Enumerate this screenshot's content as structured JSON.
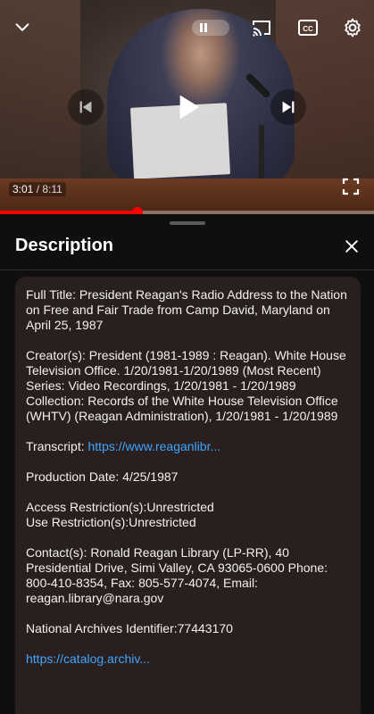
{
  "player": {
    "current_time": "3:01",
    "duration": "8:11",
    "progress_fraction": 0.368,
    "icons": {
      "minimize": "chevron-down-icon",
      "autoplay": "pause-toggle-icon",
      "cast": "cast-icon",
      "captions": "closed-captions-icon",
      "settings": "gear-icon",
      "previous": "skip-previous-icon",
      "play": "play-icon",
      "next": "skip-next-icon",
      "fullscreen": "fullscreen-icon"
    },
    "accent_color": "#ff0000"
  },
  "panel": {
    "title": "Description",
    "close_icon": "close-icon"
  },
  "description": {
    "full_title": "Full Title: President Reagan's Radio Address to the Nation on Free and Fair Trade from Camp David, Maryland on April 25, 1987",
    "creators": "Creator(s): President (1981-1989 : Reagan). White House Television Office. 1/20/1981-1/20/1989  (Most Recent)",
    "series": "Series: Video Recordings, 1/20/1981 - 1/20/1989",
    "collection": "Collection: Records of the White House Television Office (WHTV) (Reagan Administration), 1/20/1981 - 1/20/1989",
    "transcript_label": "Transcript: ",
    "transcript_link": "https://www.reaganlibr...",
    "production_date": "Production Date: 4/25/1987",
    "access_restriction": "Access Restriction(s):Unrestricted",
    "use_restriction": "Use Restriction(s):Unrestricted",
    "contacts": "Contact(s): Ronald Reagan Library (LP-RR), 40 Presidential Drive, Simi Valley, CA 93065-0600 Phone: 800-410-8354, Fax: 805-577-4074, Email: reagan.library@nara.gov",
    "archives_id": "National Archives Identifier:77443170",
    "catalog_link": "https://catalog.archiv...",
    "link_color": "#3ea6ff"
  }
}
